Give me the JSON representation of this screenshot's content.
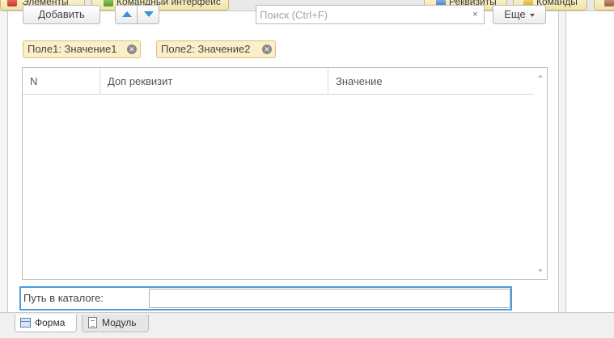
{
  "top_tabs": {
    "elements": "Элементы",
    "command_interface": "Командный интерфейс",
    "attributes": "Реквизиты",
    "commands": "Команды"
  },
  "toolbar": {
    "add_label": "Добавить",
    "search_placeholder": "Поиск (Ctrl+F)",
    "clear_label": "×",
    "more_label": "Еще"
  },
  "filters": [
    {
      "label": "Поле1: Значение1"
    },
    {
      "label": "Поле2: Значение2"
    }
  ],
  "table": {
    "columns": [
      "N",
      "Доп реквизит",
      "Значение"
    ],
    "rows": []
  },
  "path_field": {
    "label": "Путь в каталоге:",
    "value": ""
  },
  "bottom_tabs": {
    "form": "Форма",
    "module": "Модуль"
  }
}
